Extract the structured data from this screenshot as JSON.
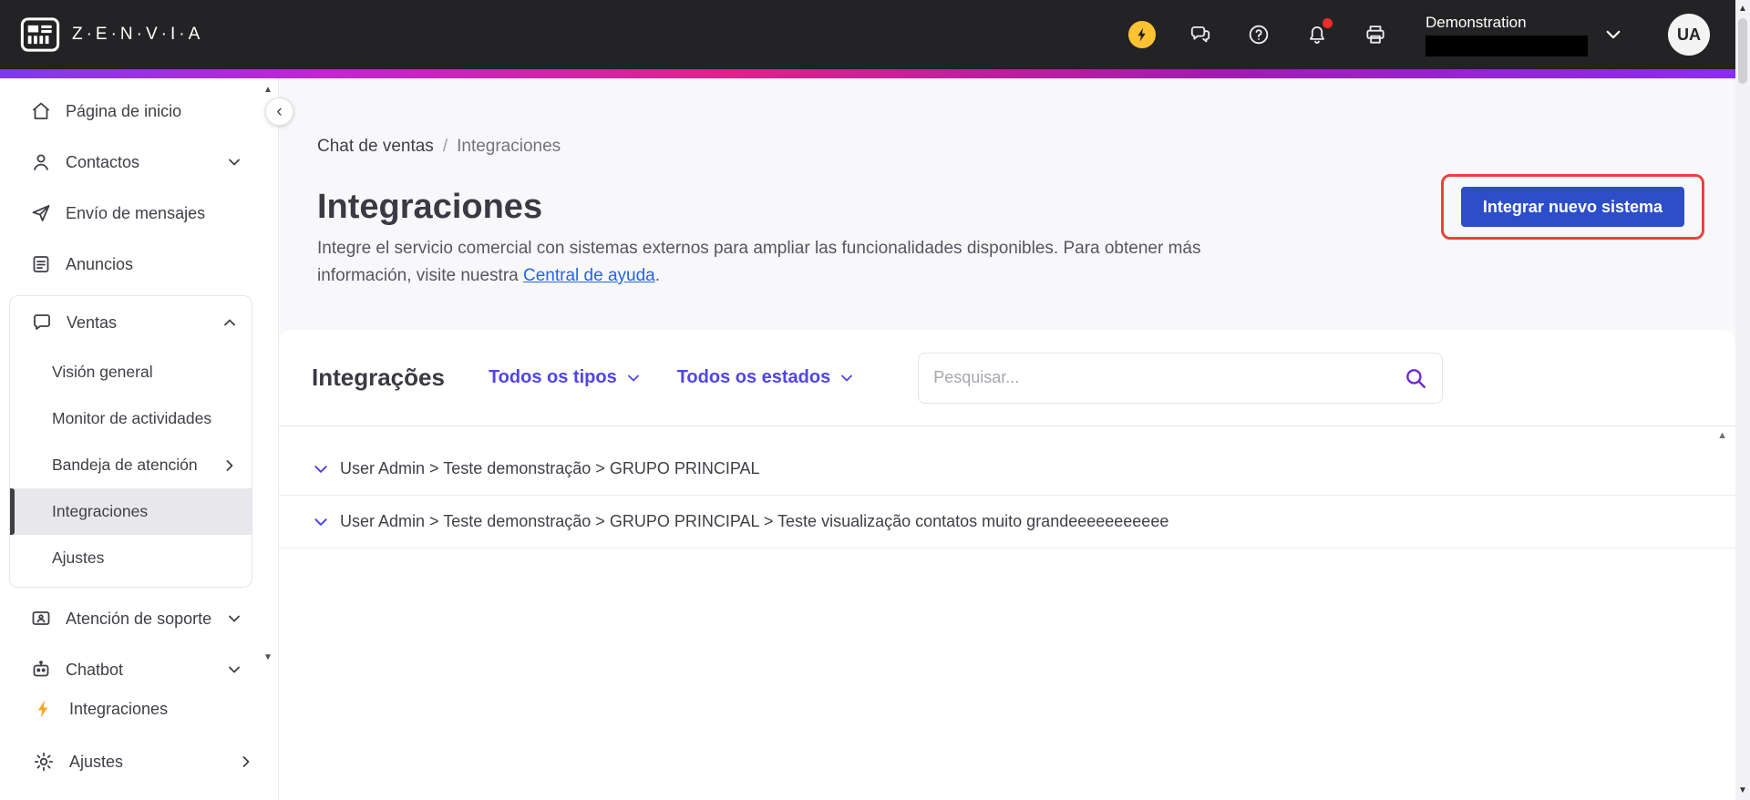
{
  "header": {
    "brand": "Z·E·N·V·I·A",
    "tenant": {
      "name": "Demonstration"
    },
    "avatar_initials": "UA",
    "icons": [
      "lightning-icon",
      "conversations-icon",
      "help-icon",
      "notifications-icon",
      "printer-icon"
    ]
  },
  "sidebar": {
    "items": [
      {
        "label": "Página de inicio",
        "icon": "home"
      },
      {
        "label": "Contactos",
        "icon": "person",
        "chevron": "down"
      },
      {
        "label": "Envío de mensajes",
        "icon": "send"
      },
      {
        "label": "Anuncios",
        "icon": "document"
      },
      {
        "label": "Ventas",
        "icon": "chat",
        "chevron": "up",
        "expanded": true,
        "children": [
          {
            "label": "Visión general"
          },
          {
            "label": "Monitor de actividades"
          },
          {
            "label": "Bandeja de atención",
            "chevron": "right"
          },
          {
            "label": "Integraciones",
            "selected": true
          },
          {
            "label": "Ajustes"
          }
        ]
      },
      {
        "label": "Atención de soporte",
        "icon": "support",
        "chevron": "down"
      },
      {
        "label": "Chatbot",
        "icon": "bot",
        "chevron": "down"
      }
    ],
    "footer_items": [
      {
        "label": "Integraciones",
        "icon": "lightning"
      },
      {
        "label": "Ajustes",
        "icon": "gear",
        "chevron": "right"
      }
    ]
  },
  "main": {
    "breadcrumb": {
      "parent": "Chat de ventas",
      "separator": "/",
      "current": "Integraciones"
    },
    "title": "Integraciones",
    "description_line1": "Integre el servicio comercial con sistemas externos para ampliar las funcionalidades disponibles. Para obtener más",
    "description_line2_prefix": "información, visite nuestra ",
    "description_link": "Central de ayuda",
    "description_suffix": ".",
    "primary_button": "Integrar nuevo sistema",
    "panel": {
      "title": "Integrações",
      "filters": [
        {
          "label": "Todos os tipos"
        },
        {
          "label": "Todos os estados"
        }
      ],
      "search_placeholder": "Pesquisar...",
      "rows": [
        {
          "label": "User Admin > Teste demonstração > GRUPO PRINCIPAL"
        },
        {
          "label": "User Admin > Teste demonstração > GRUPO PRINCIPAL > Teste visualização contatos muito grandeeeeeeeeeee"
        }
      ]
    }
  },
  "colors": {
    "header_bg": "#232326",
    "accent_purple": "#6d28d9",
    "filter_indigo": "#4f46e5",
    "primary_button_blue": "#2d4ec9",
    "annotation_red": "#e8433e",
    "link_blue": "#2563eb",
    "lightning_yellow": "#ffc233",
    "gradient_bar": [
      "#7c3aed",
      "#e0218a",
      "#8b2cf5"
    ]
  }
}
